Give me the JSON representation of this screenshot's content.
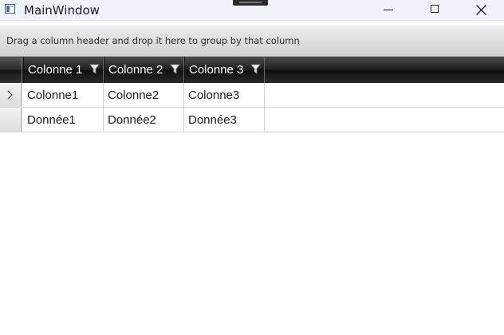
{
  "window": {
    "title": "MainWindow"
  },
  "grid": {
    "group_panel_text": "Drag a column header and drop it here to group by that column",
    "columns": [
      {
        "label": "Colonne 1"
      },
      {
        "label": "Colonne 2"
      },
      {
        "label": "Colonne 3"
      }
    ],
    "rows": [
      {
        "cells": [
          "Colonne1",
          "Colonne2",
          "Colonne3"
        ],
        "current": true
      },
      {
        "cells": [
          "Donnée1",
          "Donnée2",
          "Donnée3"
        ],
        "current": false
      }
    ]
  }
}
